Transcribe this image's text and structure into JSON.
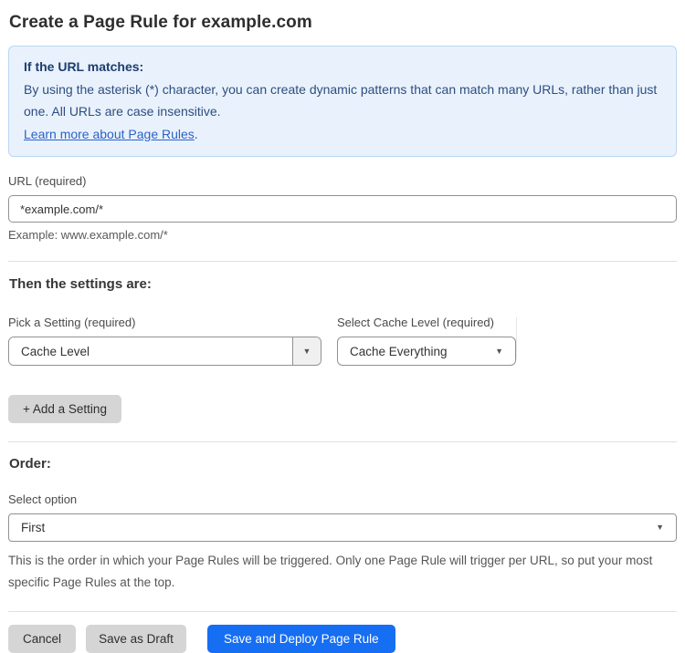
{
  "page": {
    "title": "Create a Page Rule for example.com"
  },
  "info_box": {
    "heading": "If the URL matches:",
    "body": "By using the asterisk (*) character, you can create dynamic patterns that can match many URLs, rather than just one. All URLs are case insensitive.",
    "link_label": "Learn more about Page Rules",
    "link_suffix": "."
  },
  "url_field": {
    "label": "URL (required)",
    "value": "*example.com/*",
    "example": "Example: www.example.com/*"
  },
  "settings": {
    "heading": "Then the settings are:",
    "setting_picker": {
      "label": "Pick a Setting (required)",
      "value": "Cache Level"
    },
    "cache_level": {
      "label": "Select Cache Level (required)",
      "value": "Cache Everything"
    },
    "add_button_label": "+ Add a Setting"
  },
  "order": {
    "heading": "Order:",
    "select_label": "Select option",
    "value": "First",
    "help_text": "This is the order in which your Page Rules will be triggered. Only one Page Rule will trigger per URL, so put your most specific Page Rules at the top."
  },
  "actions": {
    "cancel_label": "Cancel",
    "save_draft_label": "Save as Draft",
    "save_deploy_label": "Save and Deploy Page Rule"
  },
  "icons": {
    "dropdown_arrow": "▼"
  },
  "colors": {
    "info_bg": "#e9f2fc",
    "info_border": "#b9d8f4",
    "info_text": "#2d4d80",
    "info_heading": "#1d3d6e",
    "link_blue": "#2d62c6",
    "primary_button": "#166ef3",
    "gray_button": "#d5d5d5"
  }
}
